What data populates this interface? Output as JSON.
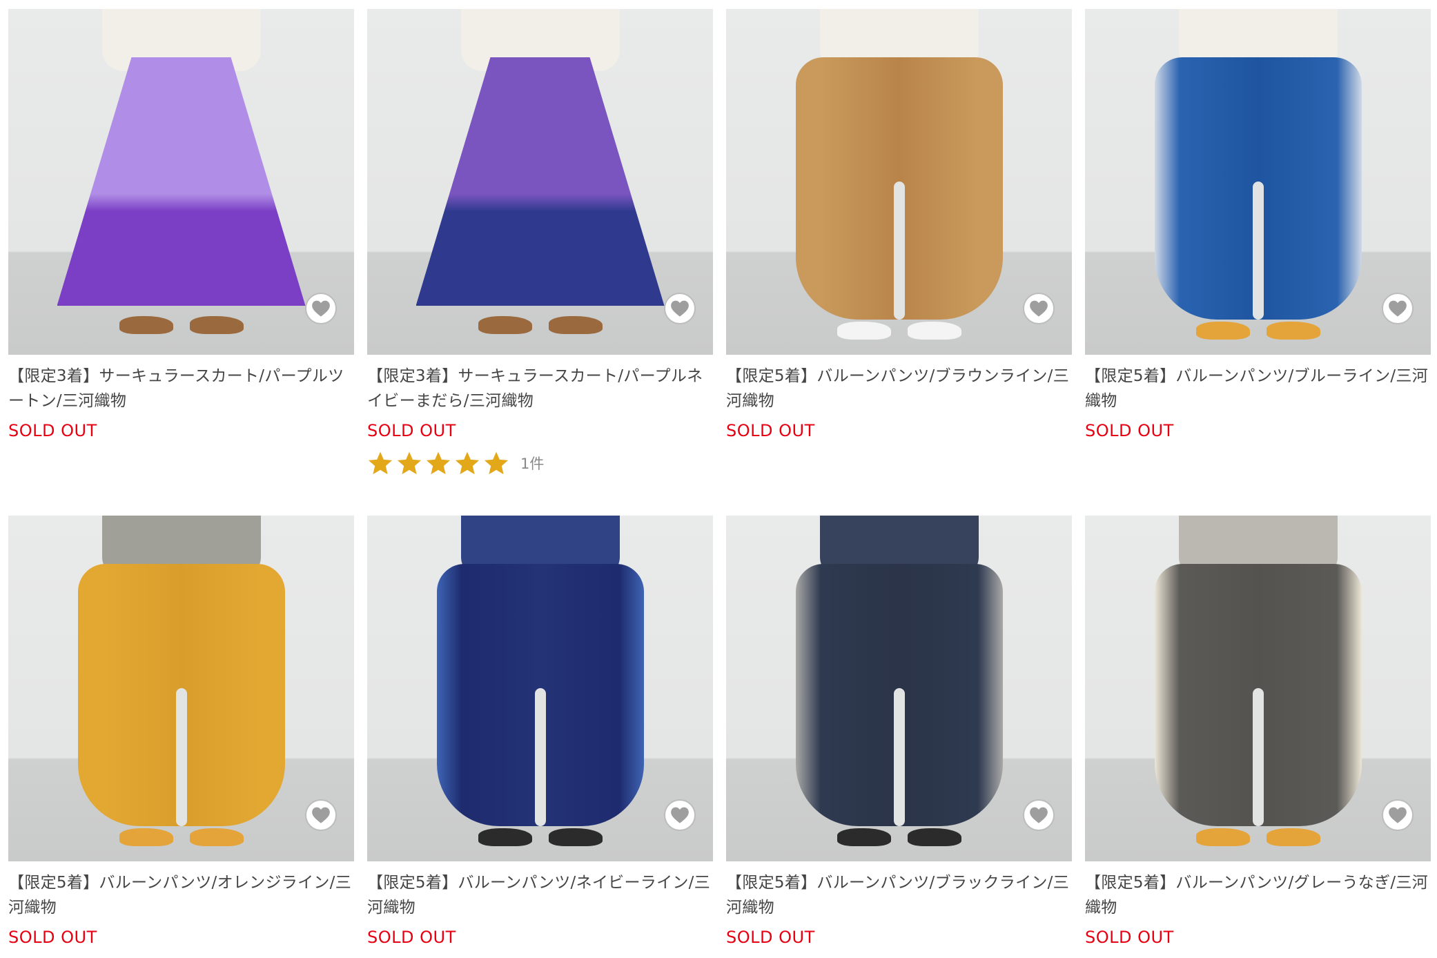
{
  "products": [
    {
      "title": "【限定3着】サーキュラースカート/パープルツートン/三河織物",
      "status": "SOLD OUT",
      "garment": "skirt",
      "colors": {
        "upper": "#b08de6",
        "lower": "#7a3fc4",
        "shoe": "#9a6a3e",
        "top": "#f1efe8"
      },
      "rating": null
    },
    {
      "title": "【限定3着】サーキュラースカート/パープルネイビーまだら/三河織物",
      "status": "SOLD OUT",
      "garment": "skirt",
      "colors": {
        "upper": "#7a55c0",
        "lower": "#2f3a8e",
        "shoe": "#9a6a3e",
        "top": "#f1efe8"
      },
      "rating": {
        "stars": 5,
        "count_label": "1件"
      }
    },
    {
      "title": "【限定5着】バルーンパンツ/ブラウンライン/三河織物",
      "status": "SOLD OUT",
      "garment": "pants",
      "colors": {
        "upper": "#c99a5c",
        "lower": "#b9844a",
        "shoe": "#f4f4f4",
        "top": "#f1efe8"
      },
      "rating": null
    },
    {
      "title": "【限定5着】バルーンパンツ/ブルーライン/三河織物",
      "status": "SOLD OUT",
      "garment": "pants",
      "colors": {
        "upper": "#2a63b0",
        "lower": "#1f55a0",
        "shoe": "#e5a43a",
        "top": "#f1efe8",
        "stripe": "#cfd8e6"
      },
      "rating": null
    },
    {
      "title": "【限定5着】バルーンパンツ/オレンジライン/三河織物",
      "status": "SOLD OUT",
      "garment": "pants",
      "colors": {
        "upper": "#e3a832",
        "lower": "#d99d2c",
        "shoe": "#e5a43a",
        "top": "#9c9c94"
      },
      "rating": null
    },
    {
      "title": "【限定5着】バルーンパンツ/ネイビーライン/三河織物",
      "status": "SOLD OUT",
      "garment": "pants",
      "colors": {
        "upper": "#1e2b6e",
        "lower": "#243276",
        "shoe": "#2b2b2b",
        "top": "#263a80",
        "stripe": "#3f64b4"
      },
      "rating": null
    },
    {
      "title": "【限定5着】バルーンパンツ/ブラックライン/三河織物",
      "status": "SOLD OUT",
      "garment": "pants",
      "colors": {
        "upper": "#2e3a50",
        "lower": "#2b3448",
        "shoe": "#2b2b2b",
        "top": "#2d3a55",
        "stripe": "#a9a8a6"
      },
      "rating": null
    },
    {
      "title": "【限定5着】バルーンパンツ/グレーうなぎ/三河織物",
      "status": "SOLD OUT",
      "garment": "pants",
      "colors": {
        "upper": "#5c5a57",
        "lower": "#55534f",
        "shoe": "#e5a43a",
        "top": "#b7b5ad",
        "stripe": "#ece6d6"
      },
      "rating": null
    }
  ],
  "icons": {
    "favorite": "heart-icon",
    "star": "star-icon"
  },
  "accent": {
    "sold_out": "#e60012",
    "star": "#e2a81a"
  }
}
